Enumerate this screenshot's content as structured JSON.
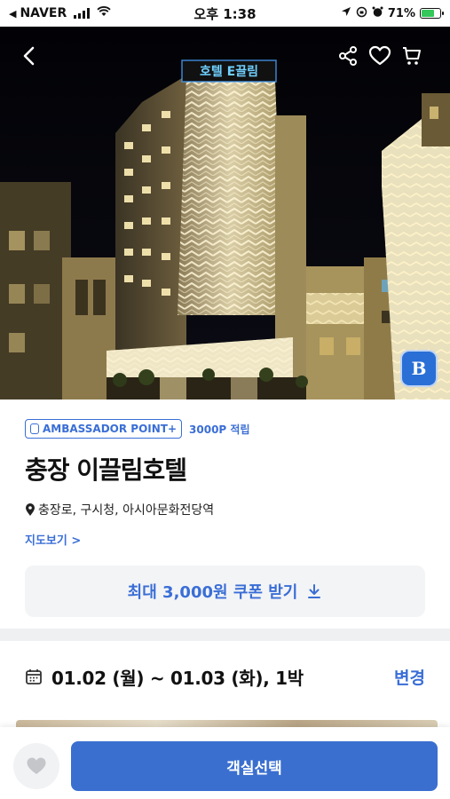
{
  "status_bar": {
    "carrier": "NAVER",
    "time": "오후 1:38",
    "battery": "71%",
    "battery_level": 0.71,
    "icons": [
      "back-triangle-icon",
      "signal-icon",
      "wifi-icon",
      "location-arrow-icon",
      "lock-rotation-icon",
      "alarm-icon",
      "battery-icon"
    ]
  },
  "hero": {
    "sign_text": "호텔 E끌림",
    "nav_icons": [
      "back-icon",
      "share-icon",
      "heart-icon",
      "cart-icon"
    ],
    "brand_badge": "B"
  },
  "points": {
    "badge_label": "AMBASSADOR POINT+",
    "reward": "3000P 적립"
  },
  "hotel": {
    "name": "충장 이끌림호텔",
    "location": "충장로, 구시청, 아시아문화전당역",
    "map_link": "지도보기 >"
  },
  "coupon": {
    "label": "최대 3,000원 쿠폰 받기"
  },
  "stay": {
    "dates": "01.02 (월) ~ 01.03 (화), 1박",
    "change_label": "변경"
  },
  "bottom": {
    "select_label": "객실선택"
  },
  "colors": {
    "accent": "#3a6ed6",
    "primary_button": "#3a6fd0",
    "battery_fill": "#34c759"
  }
}
